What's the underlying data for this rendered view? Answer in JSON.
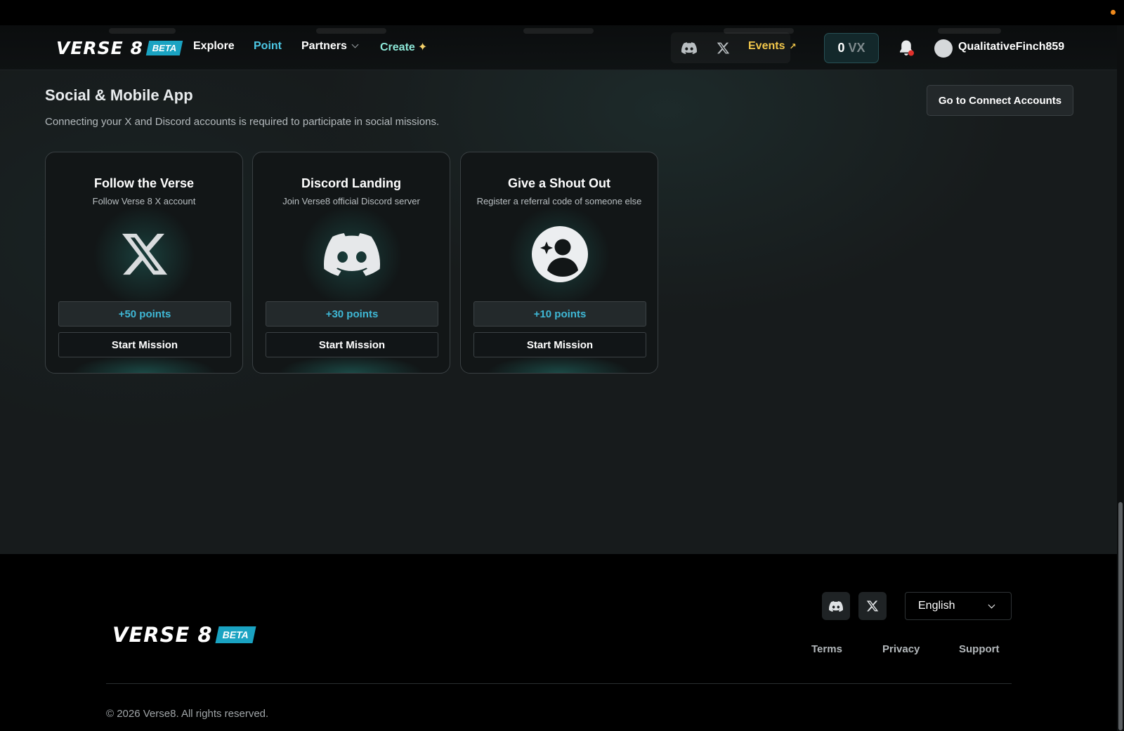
{
  "brand": {
    "name": "VERSE 8",
    "badge": "BETA"
  },
  "nav": {
    "links": [
      {
        "label": "Explore"
      },
      {
        "label": "Point"
      },
      {
        "label": "Partners"
      },
      {
        "label": "Create"
      }
    ],
    "active": "Point",
    "events_label": "Events",
    "balance": {
      "amount": "0",
      "unit": "VX"
    },
    "username": "QualitativeFinch859"
  },
  "section": {
    "title": "Social & Mobile App",
    "description": "Connecting your X and Discord accounts is required to participate in social missions.",
    "connect_button": "Go to Connect Accounts"
  },
  "missions": [
    {
      "title": "Follow the Verse",
      "subtitle": "Follow Verse 8 X account",
      "icon": "x-logo-icon",
      "points": "+50 points",
      "action": "Start Mission"
    },
    {
      "title": "Discord Landing",
      "subtitle": "Join Verse8 official Discord server",
      "icon": "discord-icon",
      "points": "+30 points",
      "action": "Start Mission"
    },
    {
      "title": "Give a Shout Out",
      "subtitle": "Register a referral code of someone else",
      "icon": "referral-user-icon",
      "points": "+10 points",
      "action": "Start Mission"
    }
  ],
  "footer": {
    "language": "English",
    "links": [
      "Terms",
      "Privacy",
      "Support"
    ],
    "copyright": "© 2026 Verse8. All rights reserved."
  },
  "colors": {
    "accent": "#4dc9e6",
    "points": "#3fb8d6",
    "events": "#f2c74b",
    "badge": "#1aa3c2",
    "notification": "#e0302b"
  }
}
